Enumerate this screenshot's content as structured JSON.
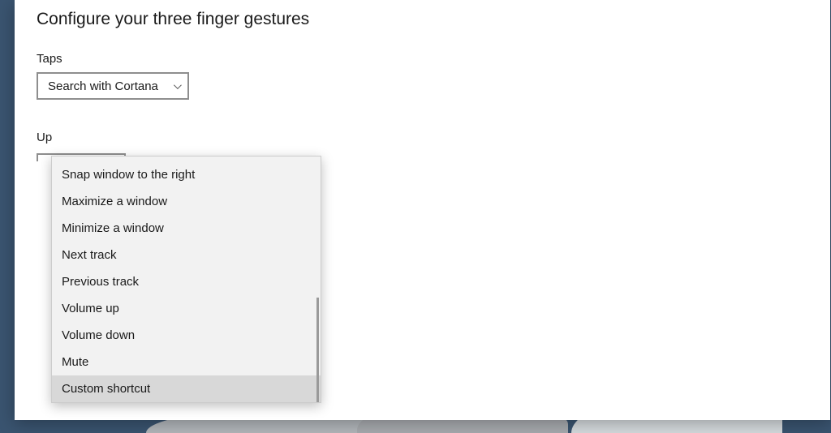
{
  "heading": "Configure your three finger gestures",
  "taps": {
    "label": "Taps",
    "selected": "Search with Cortana"
  },
  "up": {
    "label": "Up",
    "options": [
      "Snap window to the right",
      "Maximize a window",
      "Minimize a window",
      "Next track",
      "Previous track",
      "Volume up",
      "Volume down",
      "Mute",
      "Custom shortcut"
    ],
    "selected_index": 8
  }
}
